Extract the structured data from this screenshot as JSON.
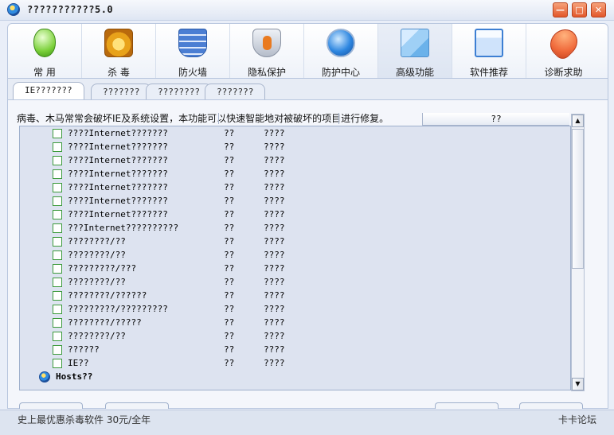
{
  "window": {
    "title": "???????????5.0",
    "minimize_glyph": "—",
    "maximize_glyph": "□",
    "close_glyph": "✕"
  },
  "toolbar": {
    "items": [
      {
        "label": "常 用",
        "icon": "mouse-icon"
      },
      {
        "label": "杀 毒",
        "icon": "lion-icon"
      },
      {
        "label": "防火墙",
        "icon": "firewall-icon"
      },
      {
        "label": "隐私保护",
        "icon": "privacy-shield-icon"
      },
      {
        "label": "防护中心",
        "icon": "globe-icon"
      },
      {
        "label": "高级功能",
        "icon": "cubes-icon",
        "active": true
      },
      {
        "label": "软件推荐",
        "icon": "window-icon"
      },
      {
        "label": "诊断求助",
        "icon": "heart-hand-icon"
      }
    ]
  },
  "subtabs": [
    "IE???????",
    "???????",
    "????????",
    "???????"
  ],
  "description": "病毒、木马常常会破坏IE及系统设置，本功能可以快速智能地对被破坏的项目进行修复。",
  "column_header": "??",
  "rows": [
    {
      "name": "????Internet???????",
      "status": "??",
      "level": "????"
    },
    {
      "name": "????Internet???????",
      "status": "??",
      "level": "????"
    },
    {
      "name": "????Internet???????",
      "status": "??",
      "level": "????"
    },
    {
      "name": "????Internet???????",
      "status": "??",
      "level": "????"
    },
    {
      "name": "????Internet???????",
      "status": "??",
      "level": "????"
    },
    {
      "name": "????Internet???????",
      "status": "??",
      "level": "????"
    },
    {
      "name": "????Internet???????",
      "status": "??",
      "level": "????"
    },
    {
      "name": "???Internet??????????",
      "status": "??",
      "level": "????"
    },
    {
      "name": "????????/??",
      "status": "??",
      "level": "????"
    },
    {
      "name": "????????/??",
      "status": "??",
      "level": "????"
    },
    {
      "name": "?????????/???",
      "status": "??",
      "level": "????"
    },
    {
      "name": "????????/??",
      "status": "??",
      "level": "????"
    },
    {
      "name": "????????/??????",
      "status": "??",
      "level": "????"
    },
    {
      "name": "?????????/?????????",
      "status": "??",
      "level": "????"
    },
    {
      "name": "????????/?????",
      "status": "??",
      "level": "????"
    },
    {
      "name": "????????/??",
      "status": "??",
      "level": "????"
    },
    {
      "name": "??????",
      "status": "??",
      "level": "????"
    },
    {
      "name": "IE??",
      "status": "??",
      "level": "????"
    }
  ],
  "hosts_group": "Hosts??",
  "status_bar": {
    "left": "史上最优惠杀毒软件 30元/全年",
    "right": "卡卡论坛"
  }
}
